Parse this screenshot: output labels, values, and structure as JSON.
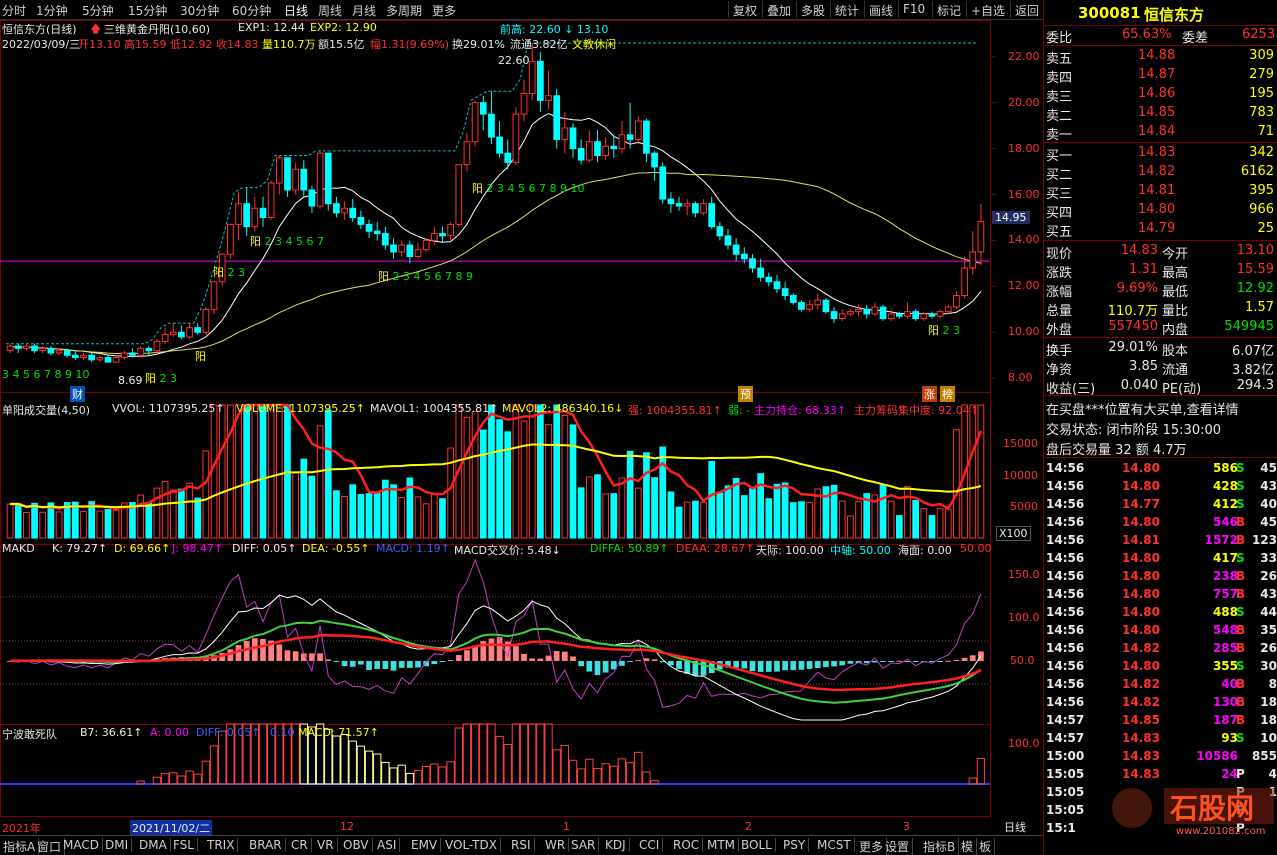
{
  "topbar": {
    "periods": [
      "分时",
      "1分钟",
      "5分钟",
      "15分钟",
      "30分钟",
      "60分钟",
      "日线",
      "周线",
      "月线",
      "多周期",
      "更多"
    ],
    "active": "日线",
    "right_buttons": [
      "复权",
      "叠加",
      "多股",
      "统计",
      "画线",
      "F10",
      "标记",
      "+自选",
      "返回"
    ]
  },
  "chart_header": {
    "stock": "恒信东方(日线)",
    "indicator": "三维黄金丹阳(10,60)",
    "exp1": "EXP1: 12.44",
    "exp2": "EXP2: 12.90",
    "info_date": "2022/03/09/三",
    "open": "开13.10",
    "high": "高15.59",
    "low": "低12.92",
    "close": "收14.83",
    "vol": "量110.7万",
    "amt": "额15.5亿",
    "pct": "幅1.31(9.69%)",
    "turnover": "换29.01%",
    "float": "流通3.82亿",
    "concept": "文教休闲",
    "prev_high": "前高: 22.60 ↓ 13.10",
    "peak": "22.60",
    "low_label": "8.69",
    "cur_price": "14.95",
    "yang_label": "阳"
  },
  "price_axis": [
    "22.00",
    "20.00",
    "18.00",
    "16.00",
    "14.00",
    "12.00",
    "10.00",
    "8.00"
  ],
  "markers": {
    "cai": "财",
    "yu": "预",
    "zhang": "涨",
    "bang": "榜"
  },
  "vol_header": {
    "name": "单阳成交量(4,50)",
    "vvol": "VVOL: 1107395.25↑",
    "volume": "VOLUME: 1107395.25↑",
    "mavol1": "MAVOL1: 1004355.81↑",
    "mavol2": "MAVOL2: 486340.16↓",
    "qiang": "强: 1004355.81↑",
    "ruo": "弱: -",
    "zhuli": "主力持仓: 68.33↑",
    "jizhong": "主力筹码集中度: 92.04↑"
  },
  "vol_axis": [
    "15000",
    "10000",
    "5000",
    "X100"
  ],
  "makd_header": {
    "name": "MAKD",
    "k": "K: 79.27↑",
    "d": "D: 69.66↑",
    "j": "J: 98.47↑",
    "diff": "DIFF: 0.05↑",
    "dea": "DEA: -0.55↑",
    "macd": "MACD: 1.19↑",
    "cross": "MACD交叉价: 5.48↓",
    "diffa": "DIFFA: 50.89↑",
    "deaa": "DEAA: 28.67↑",
    "tianji": "天际: 100.00",
    "zhongzhou": "中轴: 50.00",
    "haimian": "海面: 0.00",
    "extra": "50.00"
  },
  "makd_axis": [
    "150.0",
    "100.0",
    "50.0"
  ],
  "nb_header": {
    "name": "宁波敢死队",
    "b7": "B7: 36.61↑",
    "a": "A: 0.00",
    "diff": "DIFF: 0.05↑",
    "v": "0.10",
    "macd": "MACD: 71.57↑"
  },
  "nb_axis": [
    "100.0",
    "50.0"
  ],
  "date_axis": {
    "y2021": "2021年",
    "cursor_date": "2021/11/02/二",
    "m12": "12",
    "m1": "1",
    "m2": "2",
    "m3": "3",
    "period": "日线"
  },
  "bottombar": [
    "指标A",
    "窗口",
    "MACD",
    "DMI",
    "DMA",
    "FSL",
    "TRIX",
    "BRAR",
    "CR",
    "VR",
    "OBV",
    "ASI",
    "EMV",
    "VOL-TDX",
    "RSI",
    "WR",
    "SAR",
    "KDJ",
    "CCI",
    "ROC",
    "MTM",
    "BOLL",
    "PSY",
    "MCST",
    "更多",
    "设置"
  ],
  "bottom_right": [
    "指标B",
    "模",
    "板"
  ],
  "quote": {
    "code": "300081",
    "name": "恒信东方",
    "weibi_label": "委比",
    "weibi": "65.63%",
    "weicha_label": "委差",
    "weicha": "6253",
    "asks": [
      {
        "label": "卖五",
        "price": "14.88",
        "vol": "309"
      },
      {
        "label": "卖四",
        "price": "14.87",
        "vol": "279"
      },
      {
        "label": "卖三",
        "price": "14.86",
        "vol": "195"
      },
      {
        "label": "卖二",
        "price": "14.85",
        "vol": "783"
      },
      {
        "label": "卖一",
        "price": "14.84",
        "vol": "71"
      }
    ],
    "bids": [
      {
        "label": "买一",
        "price": "14.83",
        "vol": "342"
      },
      {
        "label": "买二",
        "price": "14.82",
        "vol": "6162"
      },
      {
        "label": "买三",
        "price": "14.81",
        "vol": "395"
      },
      {
        "label": "买四",
        "price": "14.80",
        "vol": "966"
      },
      {
        "label": "买五",
        "price": "14.79",
        "vol": "25"
      }
    ],
    "stats": [
      {
        "l1": "现价",
        "v1": "14.83",
        "l2": "今开",
        "v2": "13.10"
      },
      {
        "l1": "涨跌",
        "v1": "1.31",
        "l2": "最高",
        "v2": "15.59"
      },
      {
        "l1": "涨幅",
        "v1": "9.69%",
        "l2": "最低",
        "v2": "12.92"
      },
      {
        "l1": "总量",
        "v1": "110.7万",
        "l2": "量比",
        "v2": "1.57"
      },
      {
        "l1": "外盘",
        "v1": "557450",
        "l2": "内盘",
        "v2": "549945"
      },
      {
        "l1": "换手",
        "v1": "29.01%",
        "l2": "股本",
        "v2": "6.07亿"
      },
      {
        "l1": "净资",
        "v1": "3.85",
        "l2": "流通",
        "v2": "3.82亿"
      },
      {
        "l1": "收益(三)",
        "v1": "0.040",
        "l2": "PE(动)",
        "v2": "294.3"
      }
    ],
    "notice": "在买盘***位置有大买单,查看详情",
    "status": "交易状态: 闭市阶段 15:30:00",
    "after": "盘后交易量 32 额 4.7万",
    "ticks": [
      {
        "t": "14:56",
        "p": "14.80",
        "v": "586",
        "s": "S",
        "n": "45"
      },
      {
        "t": "14:56",
        "p": "14.80",
        "v": "428",
        "s": "S",
        "n": "43"
      },
      {
        "t": "14:56",
        "p": "14.77",
        "v": "412",
        "s": "S",
        "n": "40"
      },
      {
        "t": "14:56",
        "p": "14.80",
        "v": "546",
        "s": "B",
        "n": "45"
      },
      {
        "t": "14:56",
        "p": "14.81",
        "v": "1572",
        "s": "B",
        "n": "123"
      },
      {
        "t": "14:56",
        "p": "14.80",
        "v": "417",
        "s": "S",
        "n": "33"
      },
      {
        "t": "14:56",
        "p": "14.80",
        "v": "238",
        "s": "B",
        "n": "26"
      },
      {
        "t": "14:56",
        "p": "14.80",
        "v": "757",
        "s": "B",
        "n": "43"
      },
      {
        "t": "14:56",
        "p": "14.80",
        "v": "488",
        "s": "S",
        "n": "44"
      },
      {
        "t": "14:56",
        "p": "14.80",
        "v": "548",
        "s": "B",
        "n": "35"
      },
      {
        "t": "14:56",
        "p": "14.82",
        "v": "285",
        "s": "B",
        "n": "26"
      },
      {
        "t": "14:56",
        "p": "14.80",
        "v": "355",
        "s": "S",
        "n": "30"
      },
      {
        "t": "14:56",
        "p": "14.82",
        "v": "40",
        "s": "B",
        "n": "8"
      },
      {
        "t": "14:56",
        "p": "14.82",
        "v": "130",
        "s": "B",
        "n": "18"
      },
      {
        "t": "14:57",
        "p": "14.85",
        "v": "187",
        "s": "B",
        "n": "18"
      },
      {
        "t": "14:57",
        "p": "14.83",
        "v": "93",
        "s": "S",
        "n": "10"
      },
      {
        "t": "15:00",
        "p": "14.83",
        "v": "10586",
        "s": "",
        "n": "855"
      },
      {
        "t": "15:05",
        "p": "14.83",
        "v": "24",
        "s": "P",
        "n": "4"
      },
      {
        "t": "15:05",
        "p": "",
        "v": "",
        "s": "P",
        "n": "1"
      },
      {
        "t": "15:05",
        "p": "",
        "v": "",
        "s": "P",
        "n": ""
      },
      {
        "t": "15:1",
        "p": "",
        "v": "",
        "s": "P",
        "n": ""
      }
    ],
    "watermark": "www.201082.com"
  },
  "colors": {
    "up": "#ff3030",
    "down": "#00ffff",
    "grid": "#7a0000",
    "bg": "#000000"
  },
  "chart_data": {
    "type": "candlestick",
    "price_range": [
      7.4,
      23.6
    ],
    "candles": [
      [
        9.2,
        9.4,
        9.1,
        9.5
      ],
      [
        9.4,
        9.3,
        9.1,
        9.5
      ],
      [
        9.3,
        9.4,
        9.2,
        9.5
      ],
      [
        9.4,
        9.2,
        9.1,
        9.5
      ],
      [
        9.2,
        9.3,
        9.1,
        9.4
      ],
      [
        9.3,
        9.1,
        9.0,
        9.4
      ],
      [
        9.1,
        9.2,
        9.0,
        9.3
      ],
      [
        9.2,
        9.0,
        8.9,
        9.3
      ],
      [
        9.0,
        8.9,
        8.8,
        9.2
      ],
      [
        8.9,
        9.0,
        8.8,
        9.1
      ],
      [
        9.0,
        8.8,
        8.7,
        9.1
      ],
      [
        8.8,
        8.9,
        8.7,
        9.0
      ],
      [
        8.9,
        8.7,
        8.69,
        9.0
      ],
      [
        8.7,
        8.9,
        8.69,
        9.0
      ],
      [
        8.9,
        9.1,
        8.8,
        9.2
      ],
      [
        9.1,
        9.0,
        8.9,
        9.3
      ],
      [
        9.0,
        9.3,
        8.9,
        9.4
      ],
      [
        9.3,
        9.2,
        9.0,
        9.4
      ],
      [
        9.2,
        9.6,
        9.1,
        9.7
      ],
      [
        9.6,
        9.9,
        9.5,
        10.2
      ],
      [
        9.9,
        10.0,
        9.8,
        10.4
      ],
      [
        10.0,
        9.8,
        9.7,
        10.3
      ],
      [
        9.8,
        10.2,
        9.7,
        10.4
      ],
      [
        10.2,
        10.0,
        9.9,
        10.4
      ],
      [
        10.0,
        11.0,
        9.9,
        11.1
      ],
      [
        11.0,
        12.2,
        10.8,
        12.2
      ],
      [
        12.2,
        13.4,
        12.0,
        13.4
      ],
      [
        13.4,
        14.7,
        13.2,
        14.7
      ],
      [
        14.7,
        15.6,
        14.0,
        16.1
      ],
      [
        15.6,
        14.6,
        14.2,
        16.3
      ],
      [
        14.6,
        15.4,
        14.4,
        15.9
      ],
      [
        15.4,
        15.0,
        14.6,
        15.9
      ],
      [
        15.0,
        16.5,
        14.9,
        16.6
      ],
      [
        16.5,
        17.6,
        16.0,
        17.7
      ],
      [
        17.6,
        16.2,
        15.9,
        17.6
      ],
      [
        16.2,
        17.1,
        16.0,
        17.4
      ],
      [
        17.1,
        16.2,
        15.9,
        17.5
      ],
      [
        16.2,
        15.5,
        15.2,
        16.4
      ],
      [
        15.5,
        17.8,
        15.4,
        17.9
      ],
      [
        17.8,
        15.6,
        15.3,
        17.8
      ],
      [
        15.6,
        15.2,
        15.0,
        15.9
      ],
      [
        15.2,
        15.4,
        14.9,
        15.7
      ],
      [
        15.4,
        15.0,
        14.8,
        15.8
      ],
      [
        15.0,
        14.7,
        14.5,
        15.3
      ],
      [
        14.7,
        14.4,
        14.1,
        14.9
      ],
      [
        14.4,
        14.3,
        14.0,
        14.8
      ],
      [
        14.3,
        13.8,
        13.6,
        14.6
      ],
      [
        13.8,
        13.5,
        13.2,
        14.1
      ],
      [
        13.5,
        13.8,
        13.3,
        14.0
      ],
      [
        13.8,
        13.3,
        13.0,
        14.0
      ],
      [
        13.3,
        13.6,
        13.2,
        13.9
      ],
      [
        13.6,
        14.0,
        13.5,
        14.1
      ],
      [
        14.0,
        14.3,
        13.8,
        14.6
      ],
      [
        14.3,
        14.2,
        13.9,
        14.6
      ],
      [
        14.2,
        14.7,
        14.0,
        14.8
      ],
      [
        14.7,
        17.3,
        14.6,
        17.3
      ],
      [
        17.3,
        18.3,
        17.0,
        18.7
      ],
      [
        18.3,
        20.0,
        18.1,
        20.1
      ],
      [
        20.0,
        19.5,
        18.8,
        20.3
      ],
      [
        19.5,
        18.5,
        18.2,
        20.5
      ],
      [
        18.5,
        17.8,
        17.6,
        19.2
      ],
      [
        17.8,
        17.4,
        17.1,
        18.4
      ],
      [
        17.4,
        19.5,
        17.3,
        19.8
      ],
      [
        19.5,
        20.4,
        19.2,
        21.0
      ],
      [
        20.4,
        21.8,
        20.1,
        22.6
      ],
      [
        21.8,
        20.1,
        19.6,
        22.2
      ],
      [
        20.1,
        20.3,
        19.7,
        21.4
      ],
      [
        20.3,
        18.4,
        18.0,
        20.6
      ],
      [
        18.4,
        18.9,
        17.8,
        19.6
      ],
      [
        18.9,
        18.0,
        17.6,
        19.1
      ],
      [
        18.0,
        17.5,
        17.3,
        18.4
      ],
      [
        17.5,
        18.3,
        17.4,
        18.8
      ],
      [
        18.3,
        17.7,
        17.4,
        18.8
      ],
      [
        17.7,
        18.1,
        17.5,
        18.5
      ],
      [
        18.1,
        18.0,
        17.6,
        18.6
      ],
      [
        18.0,
        18.6,
        17.8,
        19.2
      ],
      [
        18.6,
        18.4,
        18.0,
        20.0
      ],
      [
        18.4,
        19.2,
        18.2,
        19.4
      ],
      [
        19.2,
        17.8,
        17.4,
        19.3
      ],
      [
        17.8,
        17.2,
        16.6,
        17.9
      ],
      [
        17.2,
        15.8,
        15.6,
        17.4
      ],
      [
        15.8,
        15.6,
        15.2,
        16.1
      ],
      [
        15.6,
        15.5,
        15.3,
        15.9
      ],
      [
        15.5,
        15.6,
        15.1,
        15.8
      ],
      [
        15.6,
        15.2,
        15.0,
        15.7
      ],
      [
        15.2,
        15.6,
        15.1,
        15.8
      ],
      [
        15.6,
        14.6,
        14.5,
        15.9
      ],
      [
        14.6,
        14.2,
        14.0,
        14.8
      ],
      [
        14.2,
        13.8,
        13.6,
        14.5
      ],
      [
        13.8,
        13.4,
        13.1,
        14.1
      ],
      [
        13.4,
        13.2,
        13.0,
        13.7
      ],
      [
        13.2,
        12.8,
        12.6,
        13.4
      ],
      [
        12.8,
        12.4,
        12.2,
        13.2
      ],
      [
        12.4,
        12.2,
        12.0,
        12.6
      ],
      [
        12.2,
        11.9,
        11.7,
        12.5
      ],
      [
        11.9,
        11.6,
        11.4,
        12.2
      ],
      [
        11.6,
        11.3,
        11.2,
        11.7
      ],
      [
        11.3,
        11.0,
        10.9,
        11.4
      ],
      [
        11.0,
        11.2,
        10.9,
        11.4
      ],
      [
        11.2,
        11.4,
        11.0,
        11.7
      ],
      [
        11.4,
        10.9,
        10.8,
        11.5
      ],
      [
        10.9,
        10.6,
        10.4,
        11.1
      ],
      [
        10.6,
        10.8,
        10.5,
        11.0
      ],
      [
        10.8,
        10.9,
        10.7,
        11.0
      ],
      [
        10.9,
        11.0,
        10.7,
        11.2
      ],
      [
        11.0,
        10.8,
        10.6,
        11.2
      ],
      [
        10.8,
        11.1,
        10.7,
        11.3
      ],
      [
        11.1,
        10.6,
        10.5,
        11.2
      ],
      [
        10.6,
        10.8,
        10.5,
        11.0
      ],
      [
        10.8,
        10.7,
        10.6,
        10.9
      ],
      [
        10.7,
        10.9,
        10.6,
        11.3
      ],
      [
        10.9,
        10.6,
        10.5,
        11.0
      ],
      [
        10.6,
        10.8,
        10.5,
        10.9
      ],
      [
        10.8,
        10.7,
        10.6,
        10.9
      ],
      [
        10.7,
        10.9,
        10.6,
        11.0
      ],
      [
        10.9,
        11.1,
        10.8,
        11.2
      ],
      [
        11.1,
        11.6,
        11.0,
        11.8
      ],
      [
        11.6,
        12.8,
        11.5,
        13.3
      ],
      [
        12.8,
        13.5,
        12.5,
        14.4
      ],
      [
        13.5,
        14.83,
        12.92,
        15.59
      ]
    ]
  }
}
